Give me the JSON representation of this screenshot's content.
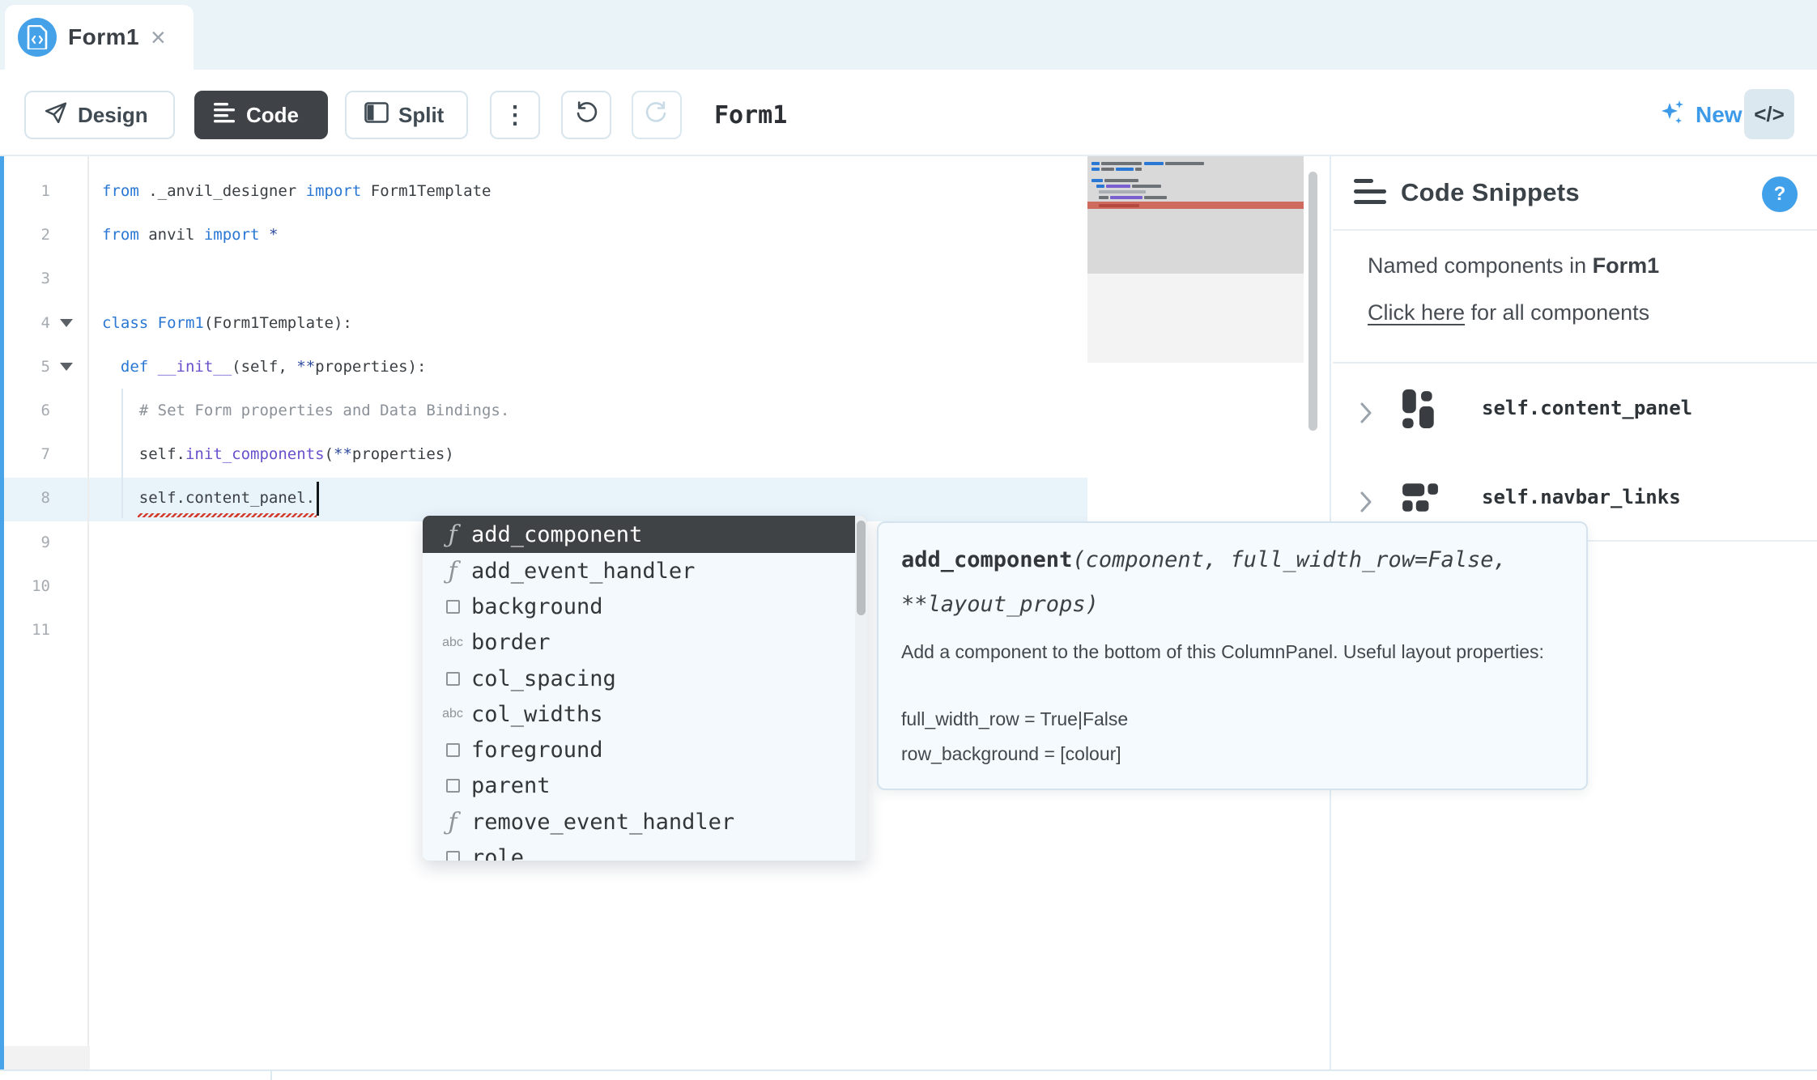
{
  "tab": {
    "title": "Form1",
    "close": "×"
  },
  "toolbar": {
    "design": "Design",
    "code": "Code",
    "split": "Split",
    "kebab": "⋮",
    "title": "Form1",
    "new_label": "New",
    "code_toggle": "</>"
  },
  "editor": {
    "current_line": 8,
    "lines": [
      {
        "n": 1,
        "fold": false,
        "segments": [
          {
            "c": "kw",
            "t": "from"
          },
          {
            "c": "pl",
            "t": " ._anvil_designer "
          },
          {
            "c": "kw",
            "t": "import"
          },
          {
            "c": "pl",
            "t": " Form1Template"
          }
        ]
      },
      {
        "n": 2,
        "fold": false,
        "segments": [
          {
            "c": "kw",
            "t": "from"
          },
          {
            "c": "pl",
            "t": " anvil "
          },
          {
            "c": "kw",
            "t": "import"
          },
          {
            "c": "pl",
            "t": " "
          },
          {
            "c": "st",
            "t": "*"
          }
        ]
      },
      {
        "n": 3,
        "fold": false,
        "segments": []
      },
      {
        "n": 4,
        "fold": true,
        "segments": [
          {
            "c": "kw",
            "t": "class"
          },
          {
            "c": "kw",
            "t": " Form1"
          },
          {
            "c": "pl",
            "t": "(Form1Template):"
          }
        ]
      },
      {
        "n": 5,
        "fold": true,
        "segments": [
          {
            "c": "pl",
            "t": "  "
          },
          {
            "c": "kw",
            "t": "def"
          },
          {
            "c": "fn",
            "t": " __init__"
          },
          {
            "c": "pl",
            "t": "(self, "
          },
          {
            "c": "st",
            "t": "**"
          },
          {
            "c": "pl",
            "t": "properties):"
          }
        ]
      },
      {
        "n": 6,
        "fold": false,
        "segments": [
          {
            "c": "cm",
            "t": "    # Set Form properties and Data Bindings."
          }
        ]
      },
      {
        "n": 7,
        "fold": false,
        "segments": [
          {
            "c": "pl",
            "t": "    self."
          },
          {
            "c": "fn",
            "t": "init_components"
          },
          {
            "c": "pl",
            "t": "("
          },
          {
            "c": "st",
            "t": "**"
          },
          {
            "c": "pl",
            "t": "properties)"
          }
        ]
      },
      {
        "n": 8,
        "fold": false,
        "segments": [
          {
            "c": "pl",
            "t": "    self.content_panel."
          }
        ]
      },
      {
        "n": 9,
        "fold": false,
        "segments": []
      },
      {
        "n": 10,
        "fold": false,
        "segments": []
      },
      {
        "n": 11,
        "fold": false,
        "segments": []
      }
    ]
  },
  "autocomplete": {
    "items": [
      {
        "icon": "function",
        "label": "add_component",
        "selected": true
      },
      {
        "icon": "function",
        "label": "add_event_handler",
        "selected": false
      },
      {
        "icon": "property",
        "label": "background",
        "selected": false
      },
      {
        "icon": "string",
        "label": "border",
        "selected": false
      },
      {
        "icon": "property",
        "label": "col_spacing",
        "selected": false
      },
      {
        "icon": "string",
        "label": "col_widths",
        "selected": false
      },
      {
        "icon": "property",
        "label": "foreground",
        "selected": false
      },
      {
        "icon": "property",
        "label": "parent",
        "selected": false
      },
      {
        "icon": "function",
        "label": "remove_event_handler",
        "selected": false
      },
      {
        "icon": "property",
        "label": "role",
        "selected": false
      }
    ],
    "string_icon_text": "abc"
  },
  "tooltip": {
    "sig_name": "add_component",
    "sig_args": "(component, full_width_row=False, **layout_props)",
    "paragraphs": [
      "Add a component to the bottom of this ColumnPanel. Useful layout properties:",
      "",
      "full_width_row = True|False",
      "row_background = [colour]"
    ]
  },
  "snippets": {
    "title": "Code Snippets",
    "help": "?",
    "named_prefix": "Named components in ",
    "named_bold": "Form1",
    "link": "Click here",
    "link_suffix": " for all components",
    "components": [
      {
        "icon": "column-panel",
        "name": "self.content_panel"
      },
      {
        "icon": "flow-panel",
        "name": "self.navbar_links"
      }
    ]
  },
  "minimap": {
    "colors": {
      "b": "#2a77d4",
      "d": "#6d7277",
      "g": "#a9afb4",
      "p": "#7a5fd0",
      "w": "#b54a40"
    },
    "band": {
      "y": 56,
      "color": "#cf6a5f",
      "segs": [
        [
          14,
          50,
          "w"
        ]
      ]
    },
    "lines": [
      {
        "y": 7,
        "segs": [
          [
            5,
            10,
            "b"
          ],
          [
            17,
            50,
            "d"
          ],
          [
            70,
            24,
            "b"
          ],
          [
            96,
            48,
            "d"
          ]
        ]
      },
      {
        "y": 14,
        "segs": [
          [
            5,
            10,
            "b"
          ],
          [
            17,
            16,
            "d"
          ],
          [
            35,
            22,
            "b"
          ],
          [
            59,
            8,
            "d"
          ]
        ]
      },
      {
        "y": 28,
        "segs": [
          [
            5,
            14,
            "b"
          ],
          [
            21,
            42,
            "d"
          ]
        ]
      },
      {
        "y": 35,
        "segs": [
          [
            11,
            10,
            "b"
          ],
          [
            23,
            30,
            "p"
          ],
          [
            55,
            36,
            "d"
          ]
        ]
      },
      {
        "y": 42,
        "segs": [
          [
            14,
            58,
            "g"
          ]
        ]
      },
      {
        "y": 49,
        "segs": [
          [
            14,
            12,
            "d"
          ],
          [
            28,
            40,
            "p"
          ],
          [
            70,
            28,
            "d"
          ]
        ]
      }
    ]
  }
}
